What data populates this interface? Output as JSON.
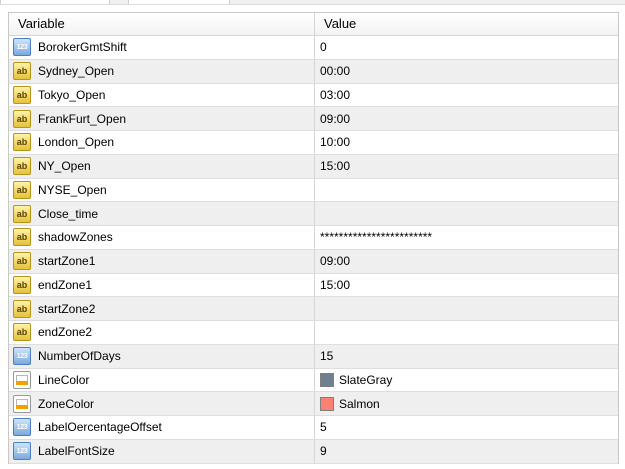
{
  "header": {
    "variable": "Variable",
    "value": "Value"
  },
  "colors": {
    "SlateGray": "#708090",
    "Salmon": "#fa8072"
  },
  "rows": [
    {
      "name": "BorokerGmtShift",
      "type": "int",
      "icon": "number-icon",
      "value": "0"
    },
    {
      "name": "Sydney_Open",
      "type": "string",
      "icon": "string-icon",
      "value": "00:00"
    },
    {
      "name": "Tokyo_Open",
      "type": "string",
      "icon": "string-icon",
      "value": "03:00"
    },
    {
      "name": "FrankFurt_Open",
      "type": "string",
      "icon": "string-icon",
      "value": "09:00"
    },
    {
      "name": "London_Open",
      "type": "string",
      "icon": "string-icon",
      "value": "10:00"
    },
    {
      "name": "NY_Open",
      "type": "string",
      "icon": "string-icon",
      "value": "15:00"
    },
    {
      "name": "NYSE_Open",
      "type": "string",
      "icon": "string-icon",
      "value": ""
    },
    {
      "name": "Close_time",
      "type": "string",
      "icon": "string-icon",
      "value": ""
    },
    {
      "name": "shadowZones",
      "type": "string",
      "icon": "string-icon",
      "value": "************************"
    },
    {
      "name": "startZone1",
      "type": "string",
      "icon": "string-icon",
      "value": "09:00"
    },
    {
      "name": "endZone1",
      "type": "string",
      "icon": "string-icon",
      "value": "15:00"
    },
    {
      "name": "startZone2",
      "type": "string",
      "icon": "string-icon",
      "value": ""
    },
    {
      "name": "endZone2",
      "type": "string",
      "icon": "string-icon",
      "value": ""
    },
    {
      "name": "NumberOfDays",
      "type": "int",
      "icon": "number-icon",
      "value": "15"
    },
    {
      "name": "LineColor",
      "type": "color",
      "icon": "color-icon",
      "value": "SlateGray",
      "swatch": "#708090"
    },
    {
      "name": "ZoneColor",
      "type": "color",
      "icon": "color-icon",
      "value": "Salmon",
      "swatch": "#fa8072"
    },
    {
      "name": "LabelOercentageOffset",
      "type": "int",
      "icon": "number-icon",
      "value": "5"
    },
    {
      "name": "LabelFontSize",
      "type": "int",
      "icon": "number-icon",
      "value": "9"
    }
  ]
}
